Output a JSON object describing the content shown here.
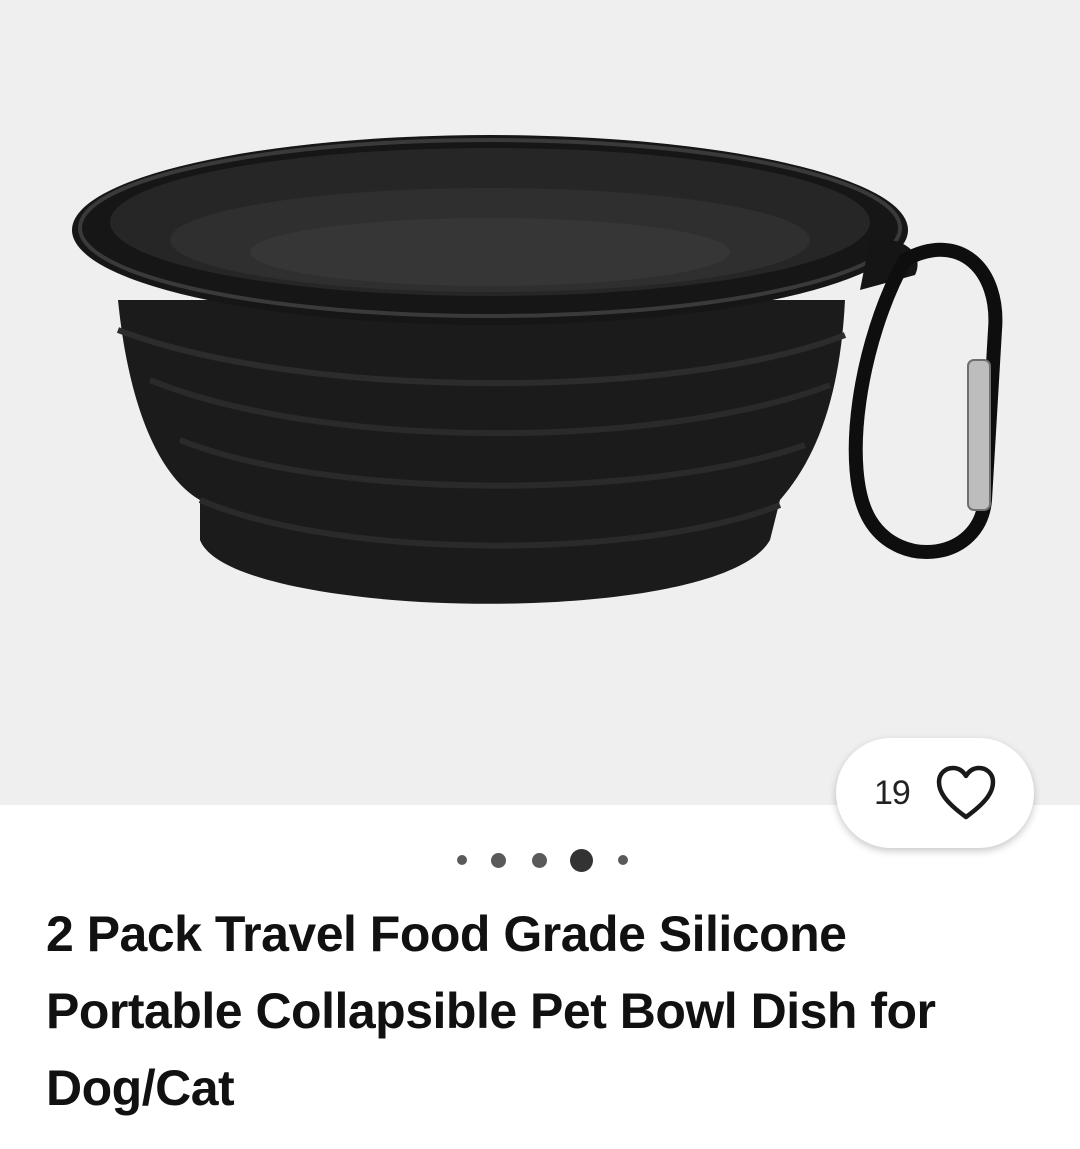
{
  "product": {
    "title": "2 Pack Travel Food Grade Silicone Portable Collapsible Pet Bowl Dish for Dog/Cat",
    "image_description_icon": "black-collapsible-silicone-bowl-with-carabiner"
  },
  "favorites": {
    "count": "19",
    "icon": "heart-outline-icon"
  },
  "carousel": {
    "total": 5,
    "active_index": 3
  },
  "colors": {
    "image_background": "#efefef",
    "dot_color": "#5a5a5a",
    "text": "#111111"
  }
}
